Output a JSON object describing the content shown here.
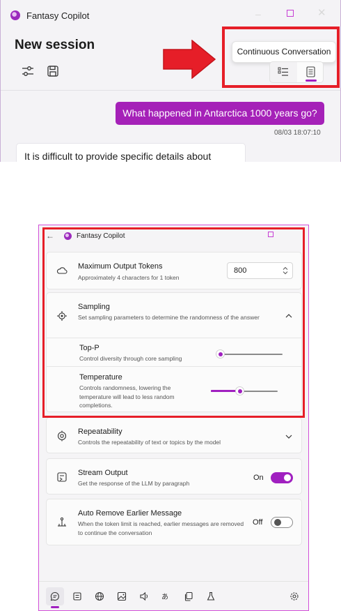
{
  "top_window": {
    "app_title": "Fantasy Copilot",
    "session_title": "New session",
    "tooltip": "Continuous Conversation",
    "toolbar_icons": [
      "sliders-icon",
      "save-icon"
    ],
    "mode_toggle": {
      "icons": [
        "list-icon",
        "document-icon"
      ],
      "selected_index": 1
    },
    "messages": {
      "user": "What happened in Antarctica 1000 years go?",
      "timestamp": "08/03 18:07:10",
      "assistant_partial": "It is difficult to provide specific details about"
    }
  },
  "bottom_window": {
    "app_title": "Fantasy Copilot",
    "settings": {
      "max_tokens": {
        "title": "Maximum Output Tokens",
        "desc": "Approximately 4 characters for 1 token",
        "value": "800"
      },
      "sampling": {
        "title": "Sampling",
        "desc": "Set sampling parameters to determine the randomness of the answer",
        "expanded": true,
        "top_p": {
          "title": "Top-P",
          "desc": "Control diversity through core sampling",
          "level": 0.0
        },
        "temperature": {
          "title": "Temperature",
          "desc": "Controls randomness, lowering the temperature will lead to less random completions.",
          "level": 0.42
        }
      },
      "repeatability": {
        "title": "Repeatability",
        "desc": "Controls the repeatability of text or topics by the model",
        "expanded": false
      },
      "stream_output": {
        "title": "Stream Output",
        "desc": "Get the response of the LLM by paragraph",
        "state_label": "On",
        "on": true
      },
      "auto_remove": {
        "title": "Auto Remove Earlier Message",
        "desc": "When the token limit is reached, earlier messages are removed to continue the conversation",
        "state_label": "Off",
        "on": false
      }
    },
    "nav_icons": [
      "chat-icon",
      "notes-icon",
      "globe-icon",
      "image-icon",
      "speaker-icon",
      "translate-icon",
      "copy-icon",
      "flask-icon",
      "settings-icon"
    ],
    "nav_selected_index": 0
  },
  "colors": {
    "accent": "#a020c0",
    "annotation_red": "#e61e28"
  }
}
